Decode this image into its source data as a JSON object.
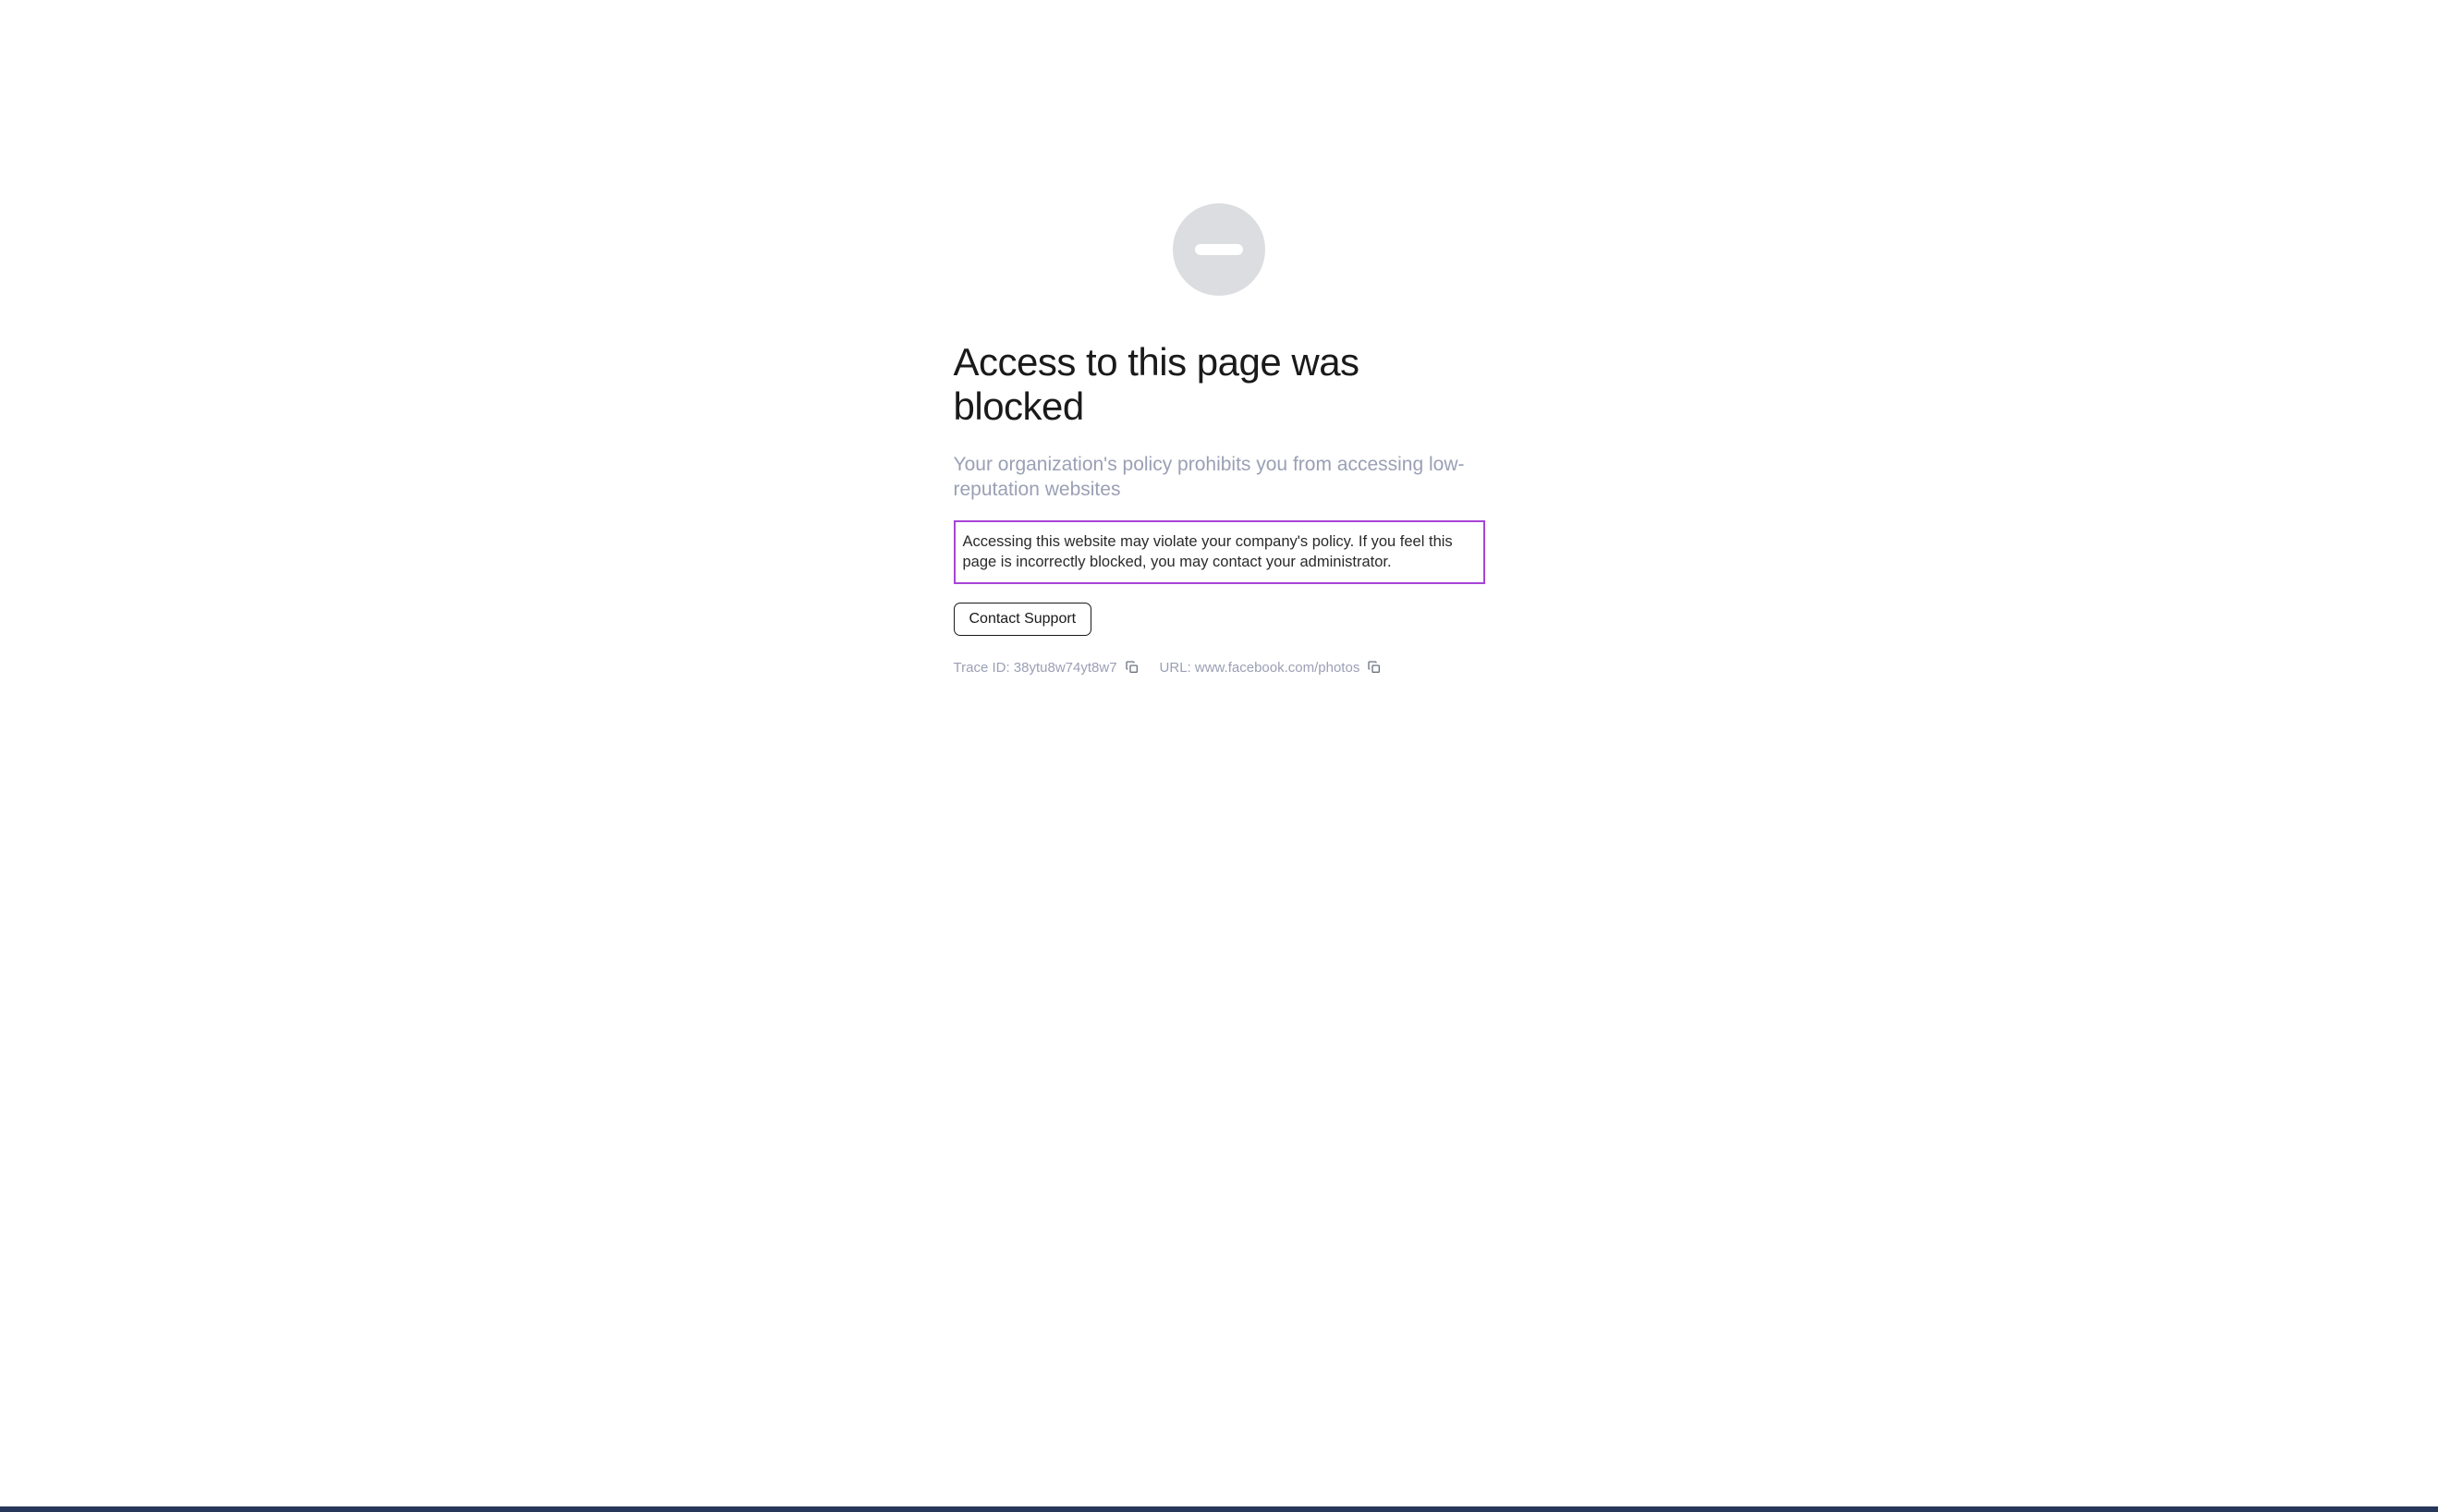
{
  "heading": "Access to this page was blocked",
  "subheading": "Your organization's policy prohibits you from accessing low-reputation websites",
  "description": "Accessing this website may violate your company's policy. If you feel this page is incorrectly blocked, you may contact your administrator.",
  "contact_button_label": "Contact Support",
  "meta": {
    "trace_id_label": "Trace ID: ",
    "trace_id_value": "38ytu8w74yt8w7",
    "url_label": "URL: ",
    "url_value": "www.facebook.com/photos"
  },
  "colors": {
    "highlight_border": "#a844d6",
    "bottom_bar": "#28365a"
  }
}
